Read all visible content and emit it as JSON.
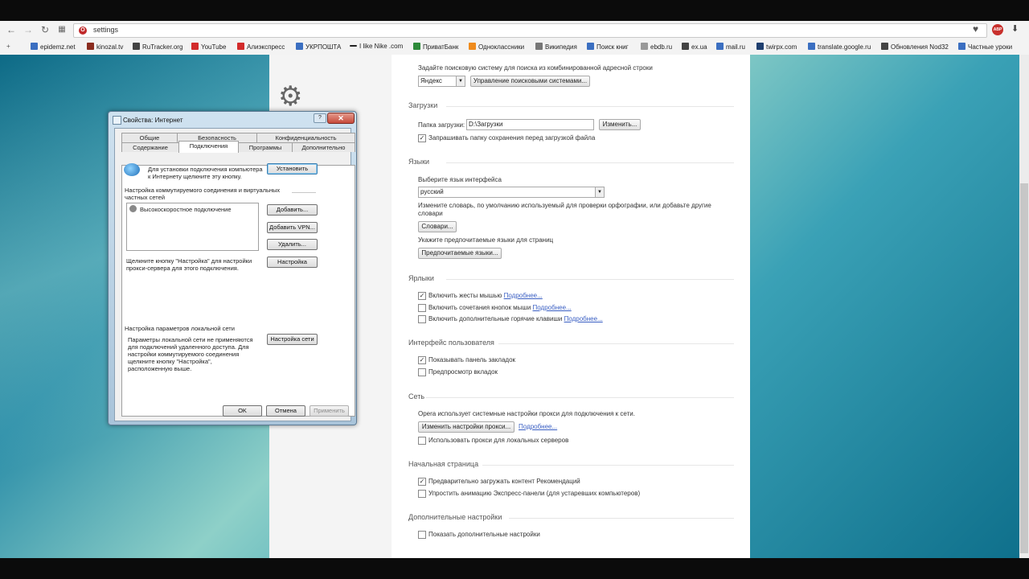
{
  "toolbar": {
    "address": "settings"
  },
  "bookmarks": [
    {
      "label": "epidemz.net",
      "color": "#3b6fc1"
    },
    {
      "label": "kinozal.tv",
      "color": "#8a2c1f"
    },
    {
      "label": "RuTracker.org",
      "color": "#444444"
    },
    {
      "label": "YouTube",
      "color": "#d22b2b"
    },
    {
      "label": "Алиэкспресс",
      "color": "#d22b2b"
    },
    {
      "label": "УКРПОШТА",
      "color": "#3b6fc1"
    },
    {
      "label": "I like Nike .com",
      "color": "#222222"
    },
    {
      "label": "ПриватБанк",
      "color": "#2d8a3a"
    },
    {
      "label": "Одноклассники",
      "color": "#ef8b1d"
    },
    {
      "label": "Википедия",
      "color": "#555555"
    },
    {
      "label": "Поиск книг",
      "color": "#3b6fc1"
    },
    {
      "label": "ebdb.ru",
      "color": "#888888"
    },
    {
      "label": "ex.ua",
      "color": "#444444"
    },
    {
      "label": "mail.ru",
      "color": "#3b6fc1"
    },
    {
      "label": "twirpx.com",
      "color": "#1f3f6f"
    },
    {
      "label": "translate.google.ru",
      "color": "#3b6fc1"
    },
    {
      "label": "Обновления Nod32",
      "color": "#444444"
    },
    {
      "label": "Частные уроки",
      "color": "#3b6fc1"
    }
  ],
  "settings": {
    "search_hint": "Задайте поисковую систему для поиска из комбинированной адресной строки",
    "search_engine": "Яндекс",
    "manage_search_btn": "Управление поисковыми системами...",
    "downloads_title": "Загрузки",
    "download_folder_label": "Папка загрузки:",
    "download_folder_value": "D:\\Загрузки",
    "change_btn": "Изменить...",
    "ask_folder": "Запрашивать папку сохранения перед загрузкой файла",
    "languages_title": "Языки",
    "choose_lang": "Выберите язык интерфейса",
    "lang_value": "русский",
    "dict_hint": "Измените словарь, по умолчанию используемый для проверки орфографии, или добавьте другие словари",
    "dict_btn": "Словари...",
    "pref_lang_hint": "Укажите предпочитаемые языки для страниц",
    "pref_lang_btn": "Предпочитаемые языки...",
    "shortcuts_title": "Ярлыки",
    "mouse_gestures": "Включить жесты мышью",
    "rocker_gestures": "Включить сочетания кнопок мыши",
    "hotkeys": "Включить дополнительные горячие клавиши",
    "more": "Подробнее...",
    "ui_title": "Интерфейс пользователя",
    "show_bookmarks_bar": "Показывать панель закладок",
    "tab_preview": "Предпросмотр вкладок",
    "network_title": "Сеть",
    "proxy_hint": "Opera использует системные настройки прокси для подключения к сети.",
    "proxy_btn": "Изменить настройки прокси...",
    "local_proxy": "Использовать прокси для локальных серверов",
    "start_title": "Начальная страница",
    "preload": "Предварительно загружать контент Рекомендаций",
    "simplify": "Упростить анимацию Экспресс-панели (для устаревших компьютеров)",
    "advanced_title": "Дополнительные настройки",
    "show_advanced": "Показать дополнительные настройки"
  },
  "dialog": {
    "title": "Свойства: Интернет",
    "help": "?",
    "close": "✕",
    "tabs_row1": [
      "Общие",
      "Безопасность",
      "Конфиденциальность"
    ],
    "tabs_row2": [
      "Содержание",
      "Подключения",
      "Программы",
      "Дополнительно"
    ],
    "setup_text": "Для установки подключения компьютера к Интернету щелкните эту кнопку.",
    "setup_btn": "Установить",
    "dialup_title": "Настройка коммутируемого соединения и виртуальных частных сетей",
    "connection_item": "Высокоскоростное подключение",
    "add_btn": "Добавить...",
    "add_vpn_btn": "Добавить VPN...",
    "remove_btn": "Удалить...",
    "settings_hint": "Щелкните кнопку \"Настройка\" для настройки прокси-сервера для этого подключения.",
    "settings_btn": "Настройка",
    "lan_title": "Настройка параметров локальной сети",
    "lan_text": "Параметры локальной сети не применяются для подключений удаленного доступа. Для настройки коммутируемого соединения щелкните кнопку \"Настройка\", расположенную выше.",
    "lan_btn": "Настройка сети",
    "ok": "OK",
    "cancel": "Отмена",
    "apply": "Применить"
  }
}
